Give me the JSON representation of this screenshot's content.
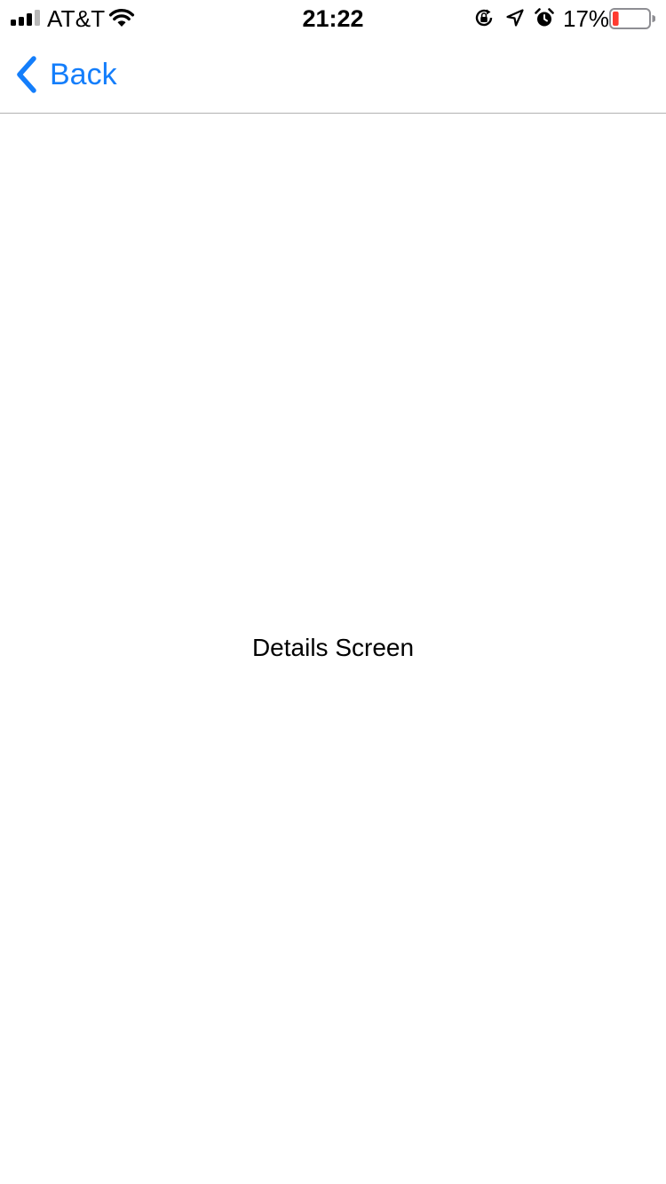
{
  "status_bar": {
    "carrier": "AT&T",
    "time": "21:22",
    "battery_percent": "17%",
    "battery_level": 0.17,
    "battery_color": "#ff3b30",
    "icons": [
      "signal-icon",
      "wifi-icon",
      "rotation-lock-icon",
      "location-icon",
      "alarm-icon",
      "battery-icon"
    ]
  },
  "nav": {
    "back_label": "Back",
    "accent_color": "#147efb"
  },
  "main": {
    "label": "Details Screen"
  }
}
